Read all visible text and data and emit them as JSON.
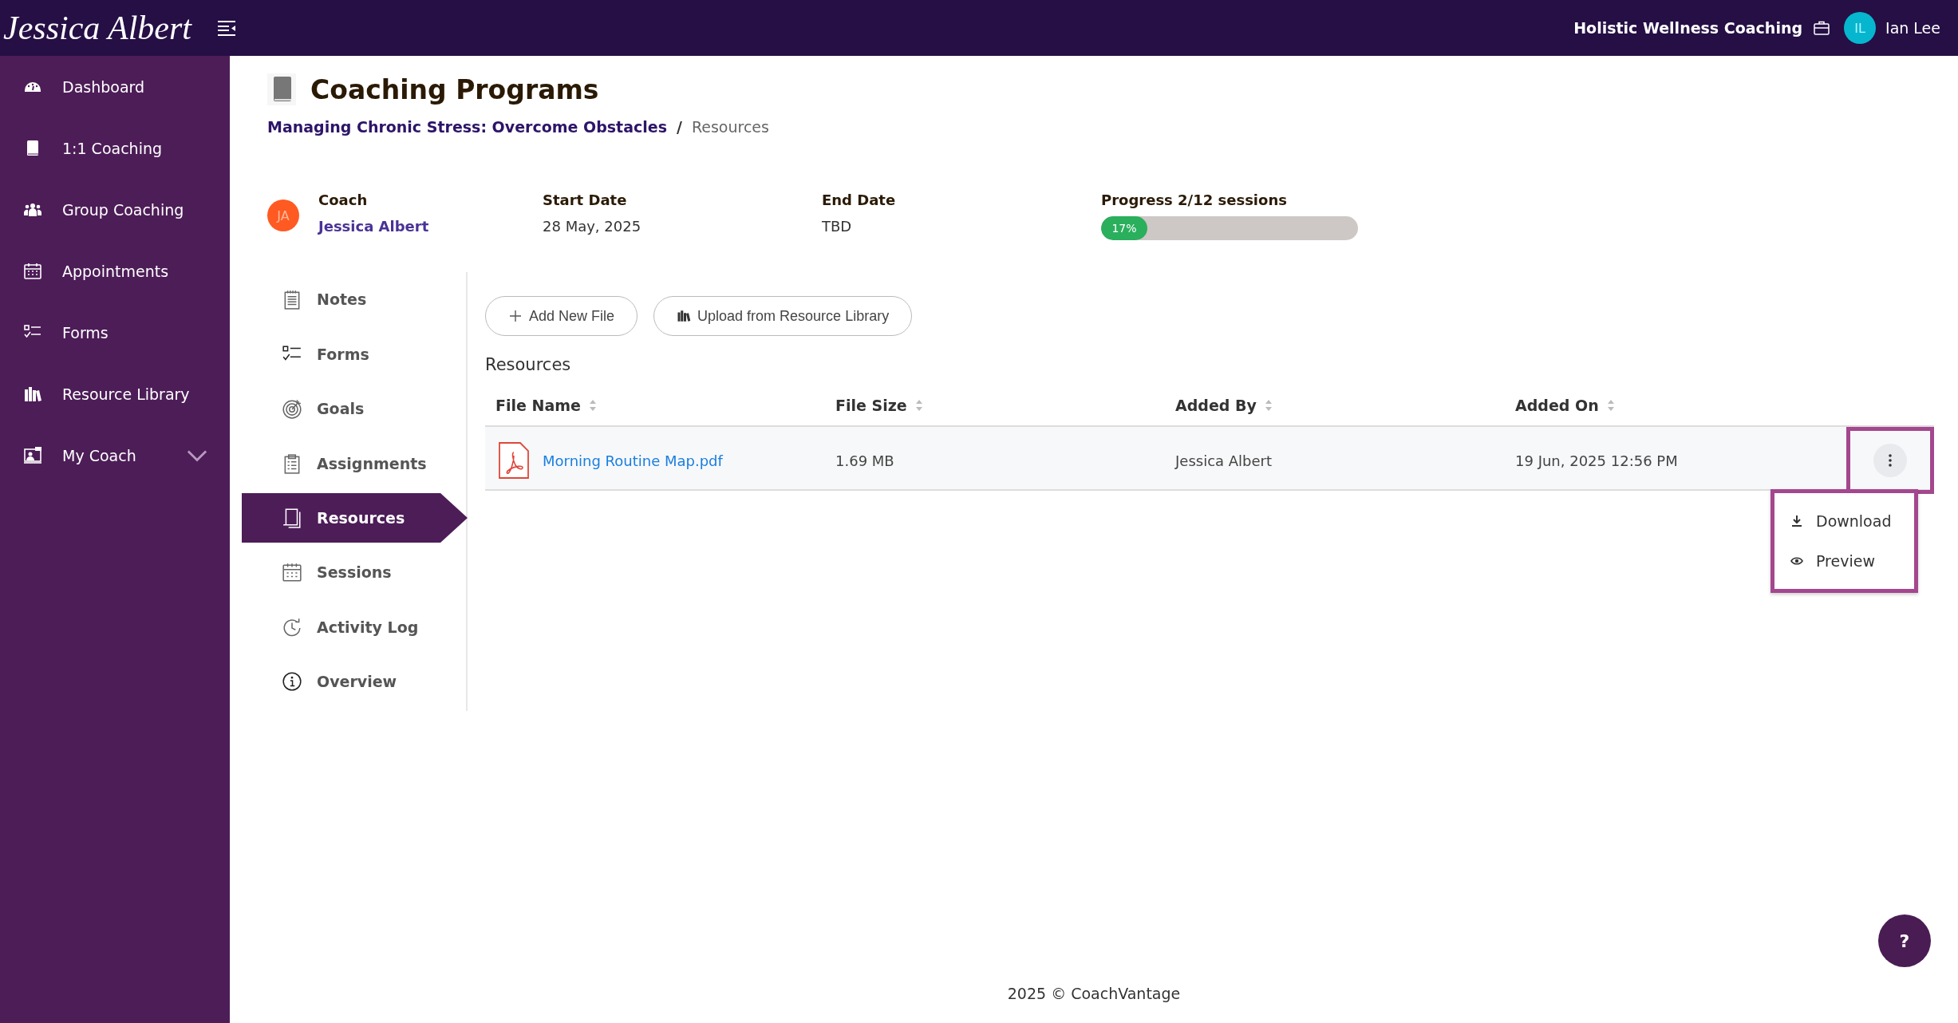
{
  "topbar": {
    "logo": "Jessica Albert",
    "organization": "Holistic Wellness Coaching",
    "user": {
      "initials": "IL",
      "name": "Ian Lee"
    }
  },
  "sidebar": {
    "items": [
      {
        "label": "Dashboard",
        "kind": "link"
      },
      {
        "label": "1:1 Coaching",
        "kind": "link"
      },
      {
        "label": "Group Coaching",
        "kind": "link"
      },
      {
        "label": "Appointments",
        "kind": "link"
      },
      {
        "label": "Forms",
        "kind": "link"
      },
      {
        "label": "Resource Library",
        "kind": "link"
      },
      {
        "label": "My Coach",
        "kind": "group"
      }
    ]
  },
  "page": {
    "title": "Coaching Programs",
    "breadcrumb": [
      {
        "label": "Managing Chronic Stress: Overcome Obstacles",
        "kind": "link"
      },
      {
        "label": "Resources",
        "kind": "current"
      }
    ],
    "separator": "/"
  },
  "info": {
    "coach": {
      "label": "Coach",
      "initials": "JA",
      "name": "Jessica Albert"
    },
    "start": {
      "label": "Start Date",
      "value": "28 May, 2025"
    },
    "end": {
      "label": "End Date",
      "value": "TBD"
    },
    "progress": {
      "label": "Progress 2/12 sessions",
      "reading": "17%",
      "level": 0.17
    }
  },
  "subnav": [
    {
      "label": "Notes",
      "selected": false
    },
    {
      "label": "Forms",
      "selected": false
    },
    {
      "label": "Goals",
      "selected": false
    },
    {
      "label": "Assignments",
      "selected": false
    },
    {
      "label": "Resources",
      "selected": true
    },
    {
      "label": "Sessions",
      "selected": false
    },
    {
      "label": "Activity Log",
      "selected": false
    },
    {
      "label": "Overview",
      "selected": false
    }
  ],
  "actions": [
    {
      "label": "Add New File",
      "kind": "add"
    },
    {
      "label": "Upload from Resource Library",
      "kind": "library"
    }
  ],
  "resources": {
    "title": "Resources",
    "columns": [
      "File Name",
      "File Size",
      "Added By",
      "Added On"
    ],
    "rows": [
      {
        "file": "Morning Routine Map.pdf",
        "size": "1.69 MB",
        "added_by": "Jessica Albert",
        "added_on": "19 Jun, 2025 12:56 PM",
        "menu_open": true
      }
    ],
    "menu": [
      {
        "label": "Download",
        "kind": "download"
      },
      {
        "label": "Preview",
        "kind": "preview"
      }
    ]
  },
  "help": {
    "label": "?"
  },
  "footer": "2025 © CoachVantage"
}
